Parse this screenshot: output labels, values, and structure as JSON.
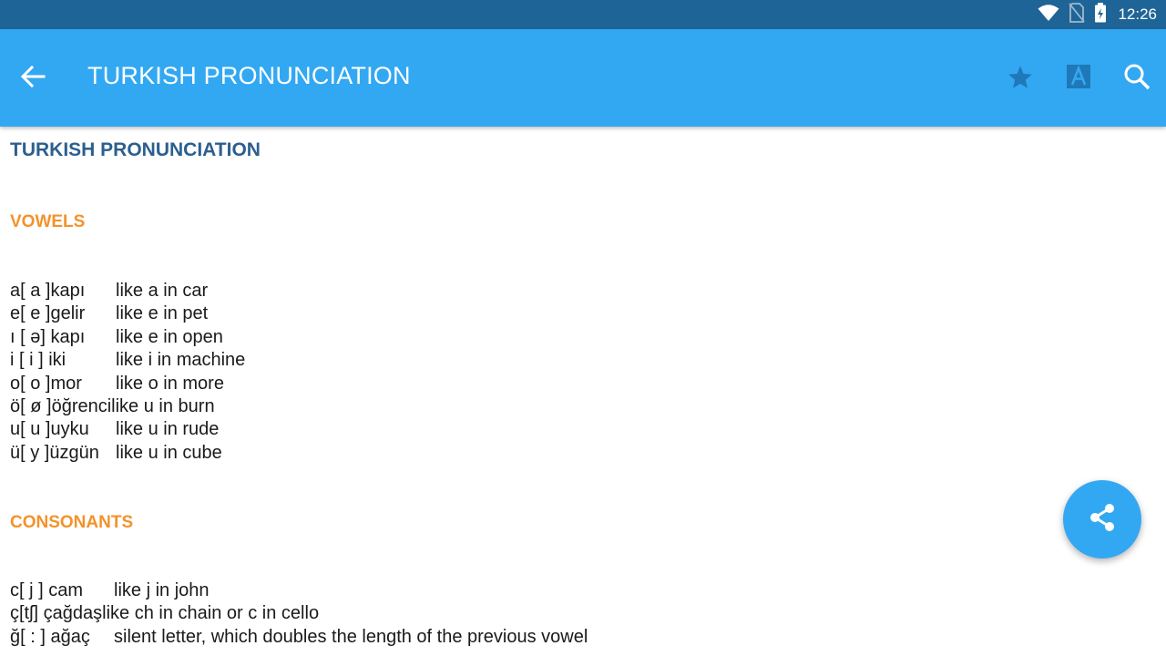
{
  "status_bar": {
    "time": "12:26",
    "icons": [
      "wifi-icon",
      "no-sim-icon",
      "battery-charging-icon"
    ]
  },
  "app_bar": {
    "title": "TURKISH PRONUNCIATION",
    "back_icon": "arrow-left-icon",
    "actions": [
      "star-icon",
      "font-size-icon",
      "search-icon"
    ]
  },
  "content": {
    "heading": "TURKISH PRONUNCIATION",
    "vowels_heading": "VOWELS",
    "vowels": [
      {
        "letter": "a[ a ]kapı",
        "desc": "like a in car"
      },
      {
        "letter": "e[ e ]gelir",
        "desc": "like e in pet"
      },
      {
        "letter": "ı [ ə] kapı",
        "desc": "like e in open"
      },
      {
        "letter": "i [ i ] iki",
        "desc": "like i in machine"
      },
      {
        "letter": "o[ o ]mor",
        "desc": "like o in more"
      },
      {
        "letter": "ö[ ø ]öğrenci",
        "desc": "like u in burn"
      },
      {
        "letter": "u[ u ]uyku",
        "desc": "like u in rude"
      },
      {
        "letter": "ü[ y ]üzgün",
        "desc": "like u in cube"
      }
    ],
    "consonants_heading": "CONSONANTS",
    "consonants": [
      {
        "letter": "c[ j ] cam",
        "desc": "like j in john"
      },
      {
        "letter": "ç[tʃ] çağdaş",
        "desc": "like ch in chain or c in cello"
      },
      {
        "letter": "ğ[ : ] ağaç",
        "desc": "silent letter, which doubles the length of the previous vowel"
      }
    ]
  },
  "fab": {
    "icon": "share-icon"
  },
  "colors": {
    "status_bar": "#1f6496",
    "app_bar": "#33a8f2",
    "heading": "#2c5f8f",
    "section": "#f4922b"
  }
}
